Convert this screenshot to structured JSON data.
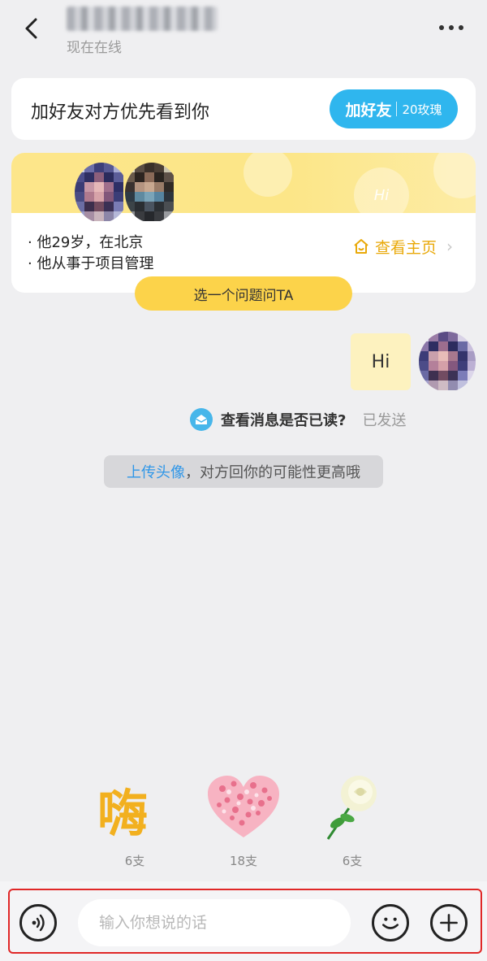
{
  "header": {
    "title": "",
    "status": "现在在线"
  },
  "friend_card": {
    "prompt": "加好友对方优先看到你",
    "button_main": "加好友",
    "button_cost": "20玫瑰"
  },
  "profile": {
    "info_lines": [
      "· 他29岁，在北京",
      "· 他从事于项目管理"
    ],
    "home_link": "查看主页",
    "deco_text": "Hi",
    "ask_button": "选一个问题问TA"
  },
  "messages": [
    {
      "text": "Hi",
      "read_prompt": "查看消息是否已读?",
      "status": "已发送"
    }
  ],
  "tip": {
    "link_text": "上传头像",
    "rest_text": "，对方回你的可能性更高哦"
  },
  "gifts": [
    {
      "name": "hai",
      "count": "6支"
    },
    {
      "name": "heart",
      "count": "18支"
    },
    {
      "name": "rose",
      "count": "6支"
    }
  ],
  "input": {
    "placeholder": "输入你想说的话"
  },
  "colors": {
    "accent_blue": "#2fb6ee",
    "accent_yellow": "#fcd34a",
    "link_orange": "#e9a90a",
    "frame_red": "#e02727"
  }
}
